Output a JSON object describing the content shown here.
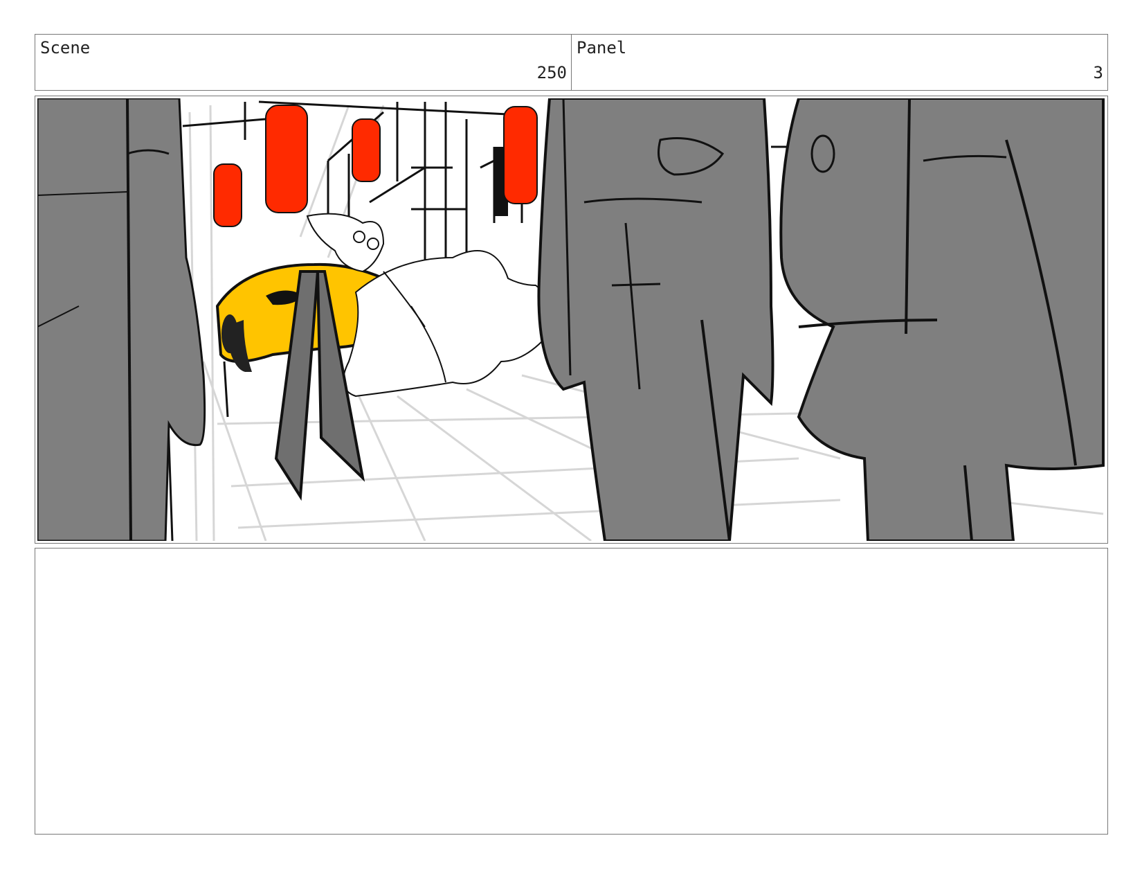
{
  "header": {
    "scene_label": "Scene",
    "scene_number": "250",
    "panel_label": "Panel",
    "panel_number": "3"
  },
  "artwork": {
    "description_icon": "storyboard-sketch",
    "colors": {
      "figure_gray": "#7f7f7f",
      "lantern_red": "#ff2a00",
      "car_yellow": "#ffc400",
      "ink": "#111111",
      "guide_gray": "#d6d6d6"
    }
  },
  "notes": {
    "text": ""
  }
}
